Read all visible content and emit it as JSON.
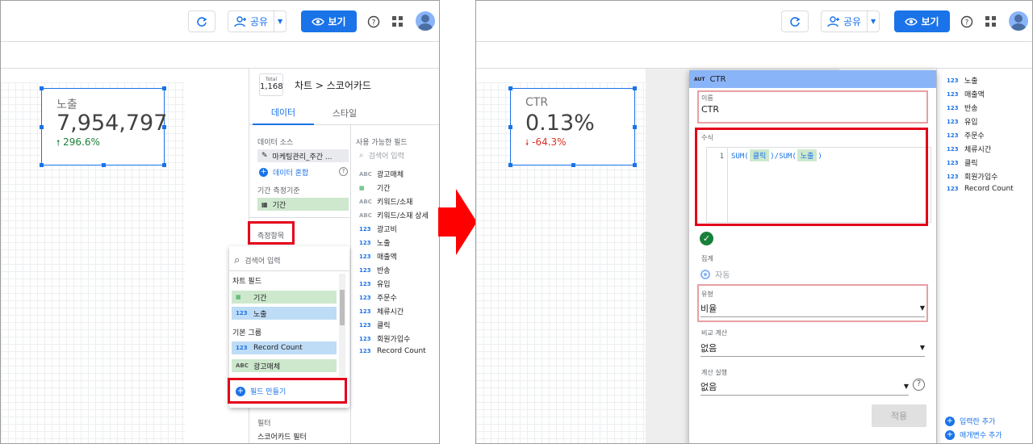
{
  "left": {
    "toolbar": {
      "share_label": "공유",
      "view_label": "보기"
    },
    "scorecard": {
      "label": "노출",
      "value": "7,954,797",
      "delta": "296.6%"
    },
    "panel": {
      "total_label": "Total",
      "total_value": "1,168",
      "breadcrumb": "차트 > 스코어카드",
      "tab_data": "데이터",
      "tab_style": "스타일",
      "data_source_title": "데이터 소스",
      "data_source_name": "마케팅관리_주간 ...",
      "blend_label": "데이터 혼합",
      "date_range_title": "기간 측정기준",
      "date_dim": "기간",
      "metric_title": "측정항목",
      "filter_title": "필터",
      "filter_sub": "스코어카드 필터",
      "available_title": "사용 가능한 필드",
      "search_placeholder": "검색어 입력",
      "available_fields": [
        {
          "type": "ABC",
          "name": "광고매체"
        },
        {
          "type": "CAL",
          "name": "기간"
        },
        {
          "type": "ABC",
          "name": "키워드/소재"
        },
        {
          "type": "ABC",
          "name": "키워드/소재 상세"
        },
        {
          "type": "123",
          "name": "광고비"
        },
        {
          "type": "123",
          "name": "노출"
        },
        {
          "type": "123",
          "name": "매출액"
        },
        {
          "type": "123",
          "name": "반송"
        },
        {
          "type": "123",
          "name": "유입"
        },
        {
          "type": "123",
          "name": "주문수"
        },
        {
          "type": "123",
          "name": "체류시간"
        },
        {
          "type": "123",
          "name": "클릭"
        },
        {
          "type": "123",
          "name": "회원가입수"
        },
        {
          "type": "123",
          "name": "Record Count"
        }
      ]
    },
    "dropdown": {
      "search_placeholder": "검색어 입력",
      "chart_fields_title": "차트 필드",
      "chart_fields": [
        {
          "type": "CAL",
          "name": "기간"
        },
        {
          "type": "123",
          "name": "노출"
        }
      ],
      "default_group_title": "기본 그룹",
      "default_fields": [
        {
          "type": "123",
          "name": "Record Count"
        },
        {
          "type": "ABC",
          "name": "광고매체"
        }
      ],
      "create_field_label": "필드 만들기"
    }
  },
  "right": {
    "toolbar": {
      "share_label": "공유",
      "view_label": "보기"
    },
    "scorecard": {
      "label": "CTR",
      "value": "0.13%",
      "delta": "-64.3%"
    },
    "background_fields": [
      "노출",
      "매출액",
      "반송",
      "유입",
      "주문수",
      "체류시간",
      "클릭",
      "회원가입수",
      "Record Count"
    ],
    "background_field_types": [
      "123",
      "123",
      "123",
      "123",
      "123",
      "123",
      "123",
      "123",
      "123"
    ],
    "add_input_label": "입력란 추가",
    "add_param_label": "매개변수 추가",
    "dialog": {
      "type_badge": "AUT",
      "title": "CTR",
      "name_label": "이름",
      "name_value": "CTR",
      "formula_label": "수식",
      "formula_line_no": "1",
      "formula_sum1": "SUM(",
      "formula_field1": "클릭",
      "formula_mid": ")/SUM(",
      "formula_field2": "노출",
      "formula_end": ")",
      "aggregation_label": "집계",
      "aggregation_value": "자동",
      "type_label": "유형",
      "type_value": "비율",
      "compare_label": "비교 계산",
      "compare_value": "없음",
      "running_label": "계산 실행",
      "running_value": "없음",
      "apply_label": "적용"
    }
  },
  "colors": {
    "accent": "#1a73e8",
    "highlight_red": "#e3001b",
    "positive": "#188038",
    "negative": "#d93025",
    "arrow_red": "#ff0000"
  }
}
